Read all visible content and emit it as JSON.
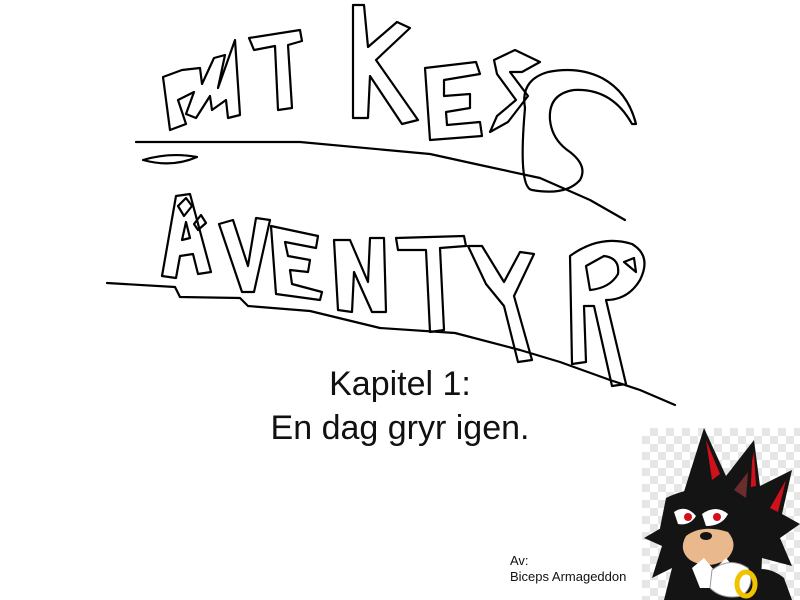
{
  "title": {
    "line1": "MIKES",
    "line2": "ÄVENTYR"
  },
  "chapter": {
    "number_label": "Kapitel 1:",
    "name": "En dag gryr igen."
  },
  "credits": {
    "by_label": "Av:",
    "author": "Biceps Armageddon"
  },
  "character_image": {
    "icon": "hedgehog-character-illustration",
    "colors": {
      "fur": "#141414",
      "stripes": "#d0111b",
      "muzzle": "#e9b98d",
      "eye": "#d40f1c",
      "glove": "#ffffff",
      "ring": "#f2c200"
    }
  }
}
